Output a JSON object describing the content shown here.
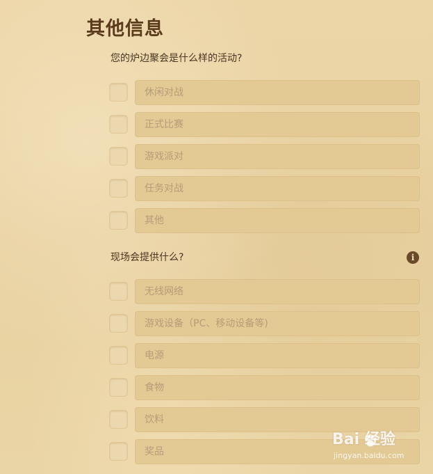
{
  "section": {
    "title": "其他信息"
  },
  "question1": {
    "label": "您的炉边聚会是什么样的活动?",
    "options": [
      {
        "label": "休闲对战",
        "checked": false
      },
      {
        "label": "正式比赛",
        "checked": false
      },
      {
        "label": "游戏派对",
        "checked": false
      },
      {
        "label": "任务对战",
        "checked": false
      },
      {
        "label": "其他",
        "checked": false
      }
    ]
  },
  "question2": {
    "label": "现场会提供什么?",
    "info_icon": "info-icon",
    "info_glyph": "i",
    "options": [
      {
        "label": "无线网络",
        "checked": false
      },
      {
        "label": "游戏设备（PC、移动设备等)",
        "checked": false
      },
      {
        "label": "电源",
        "checked": false
      },
      {
        "label": "食物",
        "checked": false
      },
      {
        "label": "饮料",
        "checked": false
      },
      {
        "label": "奖品",
        "checked": false
      }
    ]
  },
  "watermark": {
    "brand": "Bai   经验",
    "sub": "jingyan.baidu.com"
  },
  "colors": {
    "background": "#ead3a4",
    "title": "#5a3b1c",
    "option_field": "#e3c994",
    "option_text": "#b59d78",
    "info_icon": "#6b4a2a"
  }
}
